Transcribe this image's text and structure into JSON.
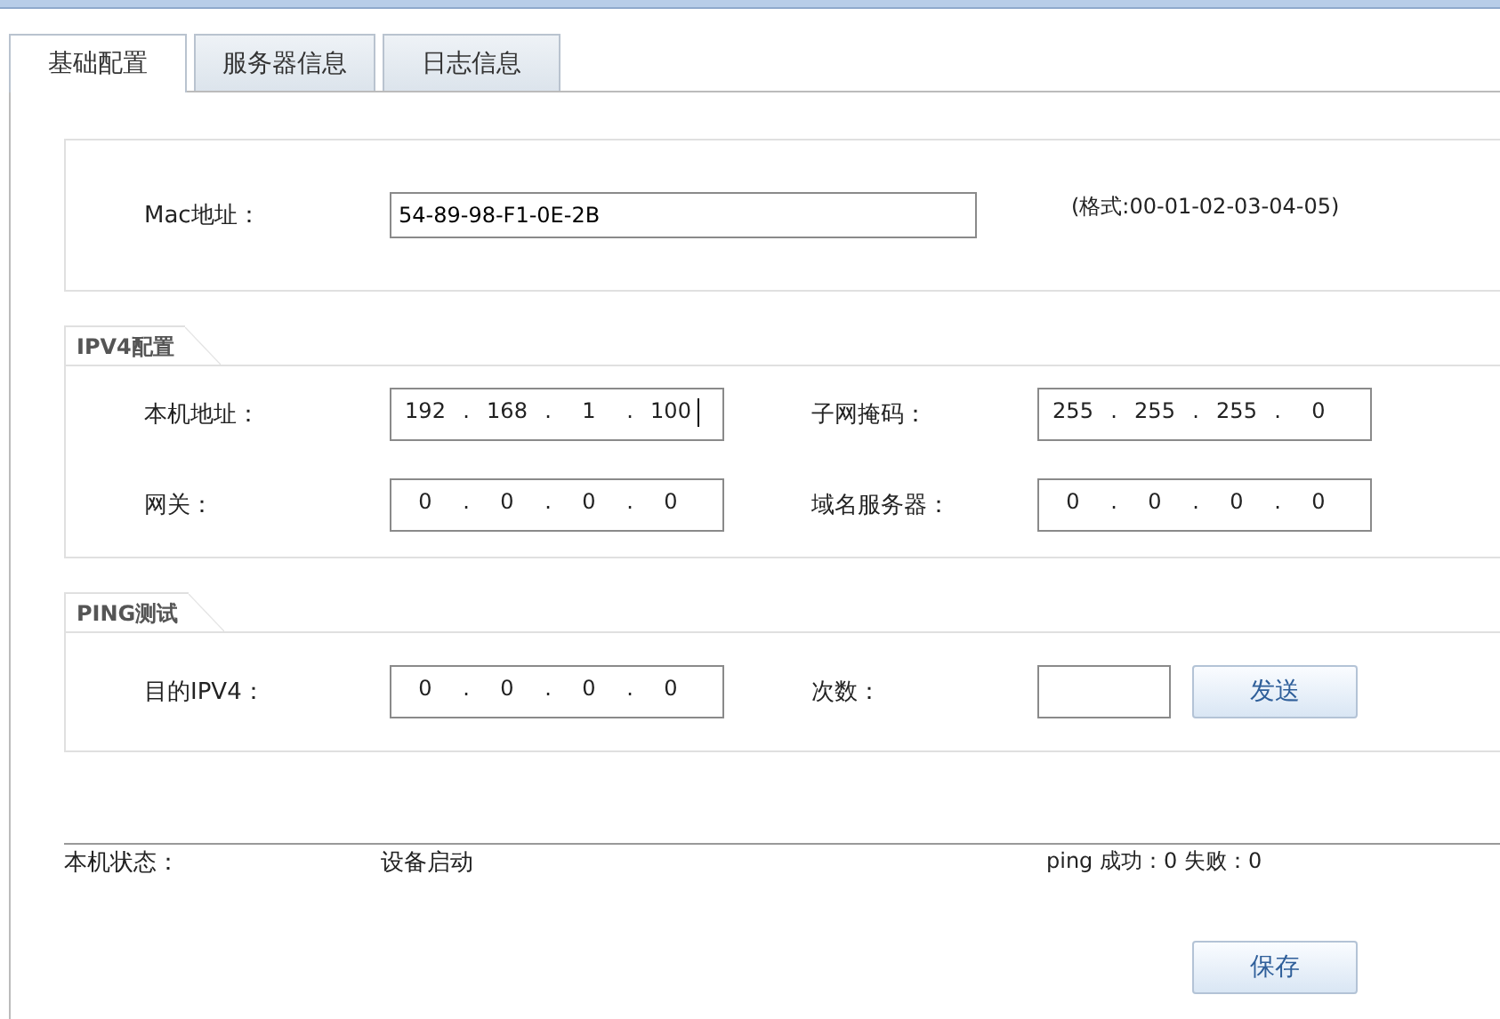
{
  "tabs": [
    {
      "label": "基础配置",
      "selected": true
    },
    {
      "label": "服务器信息",
      "selected": false
    },
    {
      "label": "日志信息",
      "selected": false
    }
  ],
  "mac": {
    "label": "Mac地址：",
    "value": "54-89-98-F1-0E-2B",
    "hint": "(格式:00-01-02-03-04-05)"
  },
  "ipv4": {
    "title": "IPV4配置",
    "fields": [
      {
        "label": "本机地址：",
        "parts": [
          "192",
          ".",
          "168",
          ".",
          "1",
          ".",
          "100"
        ],
        "focused": true
      },
      {
        "label": "子网掩码：",
        "parts": [
          "255",
          ".",
          "255",
          ".",
          "255",
          ".",
          "0"
        ],
        "focused": false
      },
      {
        "label": "网关：",
        "parts": [
          "0",
          ".",
          "0",
          ".",
          "0",
          ".",
          "0"
        ],
        "focused": false
      },
      {
        "label": "域名服务器：",
        "parts": [
          "0",
          ".",
          "0",
          ".",
          "0",
          ".",
          "0"
        ],
        "focused": false
      }
    ]
  },
  "ping": {
    "title": "PING测试",
    "target": {
      "label": "目的IPV4：",
      "parts": [
        "0",
        ".",
        "0",
        ".",
        "0",
        ".",
        "0"
      ],
      "focused": false
    },
    "count_label": "次数：",
    "send_button": "发送"
  },
  "status": {
    "label": "本机状态：",
    "value": "设备启动",
    "ping_result": "ping 成功：0 失败：0"
  },
  "save_button": "保存"
}
